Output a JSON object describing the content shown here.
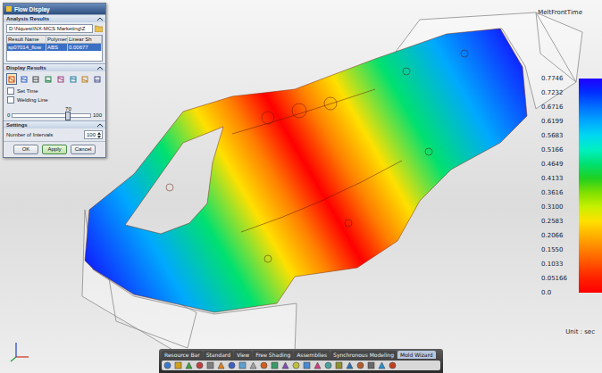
{
  "dialog": {
    "title": "Flow Display",
    "analysis_results": {
      "header": "Analysis Results",
      "path": "D:\\Nquest\\NX-MCS Marketing\\Z",
      "columns": [
        "Result Name",
        "Polymer",
        "Linear Sh"
      ],
      "rows": [
        {
          "cells": [
            "sp07014_flow",
            "ABS",
            "0.00677"
          ],
          "selected": true
        }
      ]
    },
    "display_results": {
      "header": "Display Results",
      "tools": [
        {
          "selected": true
        },
        {
          "selected": false
        },
        {
          "selected": false
        },
        {
          "selected": false
        },
        {
          "selected": false
        },
        {
          "selected": false
        },
        {
          "selected": false
        },
        {
          "selected": false
        }
      ],
      "options": [
        {
          "label": "Set Time",
          "checked": false
        },
        {
          "label": "Welding Line",
          "checked": false
        }
      ],
      "slider": {
        "value": "70",
        "min": "0",
        "max": "100",
        "level": 0.7
      }
    },
    "settings": {
      "header": "Settings",
      "fields": [
        {
          "label": "Number of Intervals",
          "value": "100"
        }
      ]
    },
    "buttons": [
      {
        "label": "OK",
        "selected": false
      },
      {
        "label": "Apply",
        "selected": true
      },
      {
        "label": "Cancel",
        "selected": false
      }
    ]
  },
  "legend": {
    "title": "MeltFrontTime",
    "unit": "Unit : sec",
    "entries": [
      {
        "value": "0.7746",
        "color": "#2000ff"
      },
      {
        "value": "0.7232",
        "color": "#0030ff"
      },
      {
        "value": "0.6716",
        "color": "#0070ff"
      },
      {
        "value": "0.6199",
        "color": "#00a8ff"
      },
      {
        "value": "0.5683",
        "color": "#00d8f0"
      },
      {
        "value": "0.5166",
        "color": "#00f0c0"
      },
      {
        "value": "0.4649",
        "color": "#00e070"
      },
      {
        "value": "0.4133",
        "color": "#20d020"
      },
      {
        "value": "0.3616",
        "color": "#80e000"
      },
      {
        "value": "0.3100",
        "color": "#c8f000"
      },
      {
        "value": "0.2583",
        "color": "#ffe000"
      },
      {
        "value": "0.2066",
        "color": "#ffb000"
      },
      {
        "value": "0.1550",
        "color": "#ff8000"
      },
      {
        "value": "0.1033",
        "color": "#ff5000"
      },
      {
        "value": "0.05166",
        "color": "#ff2000"
      },
      {
        "value": "0.0",
        "color": "#ff0000"
      }
    ]
  },
  "toolbar": {
    "tabs": [
      {
        "label": "Resource Bar",
        "selected": false
      },
      {
        "label": "Standard",
        "selected": false
      },
      {
        "label": "View",
        "selected": false
      },
      {
        "label": "Free Shading",
        "selected": false
      },
      {
        "label": "Assemblies",
        "selected": false
      },
      {
        "label": "Synchronous Modeling",
        "selected": false
      },
      {
        "label": "Mold Wizard",
        "selected": true
      }
    ]
  }
}
